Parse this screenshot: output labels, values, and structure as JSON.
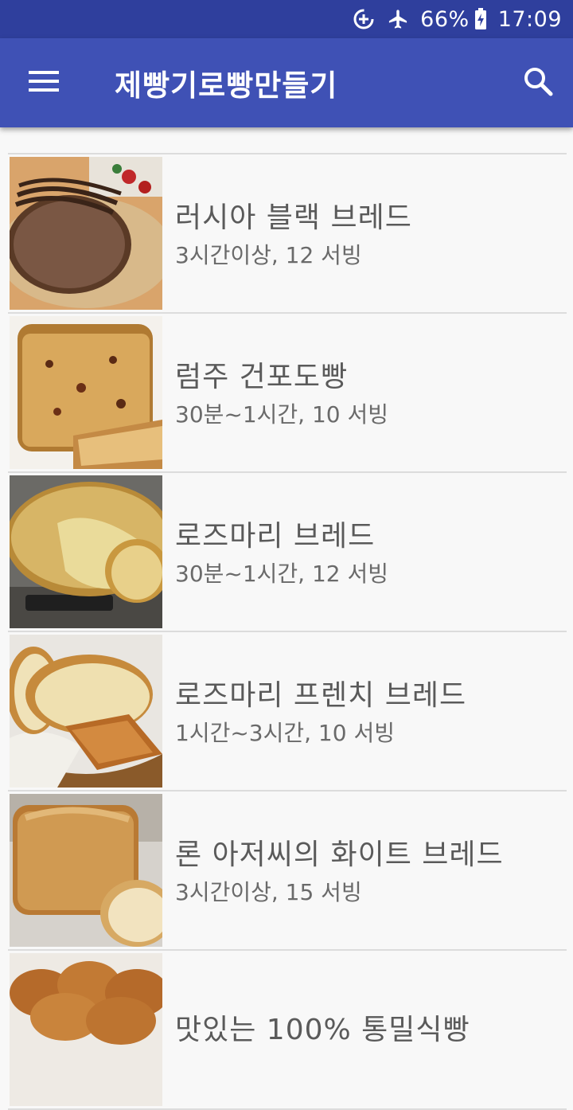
{
  "status_bar": {
    "battery_percent": "66%",
    "time": "17:09",
    "icons": [
      "data-saver-icon",
      "airplane-mode-icon",
      "battery-charging-icon"
    ]
  },
  "app_bar": {
    "title": "제빵기로빵만들기",
    "menu_icon": "hamburger-menu-icon",
    "search_icon": "search-icon",
    "color": "#3f51b5",
    "status_color": "#2f3f9d"
  },
  "recipes": [
    {
      "title": "러시아 블랙 브레드",
      "meta": "3시간이상, 12 서빙",
      "image": "russian-black-bread-photo"
    },
    {
      "title": "럼주 건포도빵",
      "meta": "30분~1시간, 10 서빙",
      "image": "rum-raisin-bread-photo"
    },
    {
      "title": "로즈마리 브레드",
      "meta": "30분~1시간, 12 서빙",
      "image": "rosemary-bread-photo"
    },
    {
      "title": "로즈마리 프렌치 브레드",
      "meta": "1시간~3시간, 10 서빙",
      "image": "rosemary-french-bread-photo"
    },
    {
      "title": "론 아저씨의 화이트 브레드",
      "meta": "3시간이상, 15 서빙",
      "image": "white-bread-photo"
    },
    {
      "title": "맛있는 100% 통밀식빵",
      "meta": "",
      "image": "whole-wheat-bread-photo"
    }
  ]
}
